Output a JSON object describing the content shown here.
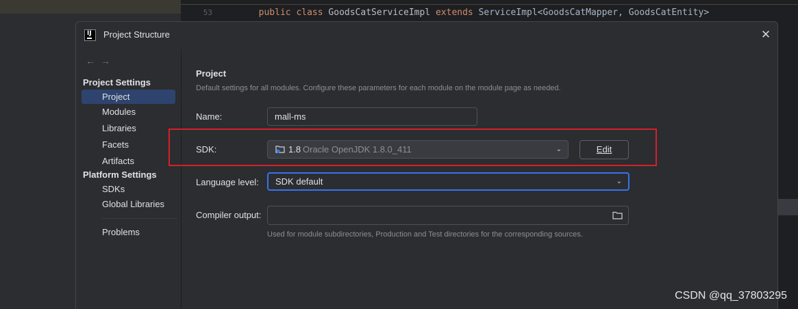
{
  "background": {
    "line_number": "53",
    "code": {
      "kw1": "public",
      "kw2": "class",
      "cls": "GoodsCatServiceImpl",
      "kw3": "extends",
      "rest": "ServiceImpl<GoodsCatMapper, GoodsCatEntity>"
    }
  },
  "watermark": "CSDN @qq_37803295",
  "dialog": {
    "title": "Project Structure",
    "app_icon": "intellij-icon",
    "close_glyph": "✕"
  },
  "sidebar": {
    "nav_back": "←",
    "nav_forward": "→",
    "project_settings_title": "Project Settings",
    "project_items": [
      {
        "label": "Project",
        "selected": true
      },
      {
        "label": "Modules"
      },
      {
        "label": "Libraries"
      },
      {
        "label": "Facets"
      },
      {
        "label": "Artifacts"
      }
    ],
    "platform_settings_title": "Platform Settings",
    "platform_items": [
      {
        "label": "SDKs"
      },
      {
        "label": "Global Libraries"
      }
    ],
    "problems": "Problems"
  },
  "content": {
    "heading": "Project",
    "description": "Default settings for all modules. Configure these parameters for each module on the module page as needed.",
    "name_label": "Name:",
    "name_value": "mall-ms",
    "sdk_label": "SDK:",
    "sdk_version": "1.8",
    "sdk_name": "Oracle OpenJDK 1.8.0_411",
    "edit_button": "Edit",
    "language_label": "Language level:",
    "language_value": "SDK default",
    "compiler_label": "Compiler output:",
    "compiler_value": "",
    "hint": "Used for module subdirectories, Production and Test directories for the corresponding sources."
  },
  "colors": {
    "accent": "#3574f0",
    "selection": "#2e436e",
    "annotation": "#d6202a"
  }
}
